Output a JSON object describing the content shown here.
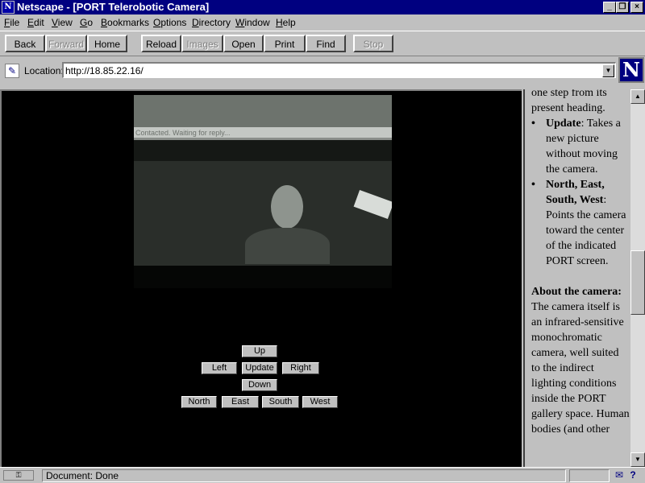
{
  "window": {
    "title": "Netscape - [PORT Telerobotic Camera]",
    "controls": [
      "_",
      "❐",
      "×"
    ]
  },
  "menu": [
    {
      "key": "F",
      "rest": "ile"
    },
    {
      "key": "E",
      "rest": "dit"
    },
    {
      "key": "V",
      "rest": "iew"
    },
    {
      "key": "G",
      "rest": "o"
    },
    {
      "key": "B",
      "rest": "ookmarks"
    },
    {
      "key": "O",
      "rest": "ptions"
    },
    {
      "key": "D",
      "rest": "irectory"
    },
    {
      "key": "W",
      "rest": "indow"
    },
    {
      "key": "H",
      "rest": "elp"
    }
  ],
  "toolbar": {
    "back": "Back",
    "forward": "Forward",
    "home": "Home",
    "reload": "Reload",
    "images": "Images",
    "open": "Open",
    "print": "Print",
    "find": "Find",
    "stop": "Stop"
  },
  "location": {
    "label": "Location:",
    "url": "http://18.85.22.16/"
  },
  "brand_logo": "N",
  "camera": {
    "caption": "Contacted. Waiting for reply..."
  },
  "controls": {
    "up": "Up",
    "left": "Left",
    "update": "Update",
    "right": "Right",
    "down": "Down",
    "north": "North",
    "east": "East",
    "south": "South",
    "west": "West"
  },
  "help_text": {
    "line_a": "one step from its present heading.",
    "update_term": "Update",
    "update_desc": ": Takes a new picture without moving the camera.",
    "compass_term": "North, East, South, West",
    "compass_desc": ": Points the camera toward the center of the indicated PORT screen.",
    "about_heading": "About the camera:",
    "about_body": "The camera itself is an infrared-sensitive monochromatic camera, well suited to the indirect lighting conditions inside the PORT gallery space. Human bodies (and other"
  },
  "status": {
    "text": "Document: Done"
  },
  "colors": {
    "titlebar": "#000080",
    "chrome": "#c0c0c0",
    "content_bg": "#000000"
  }
}
